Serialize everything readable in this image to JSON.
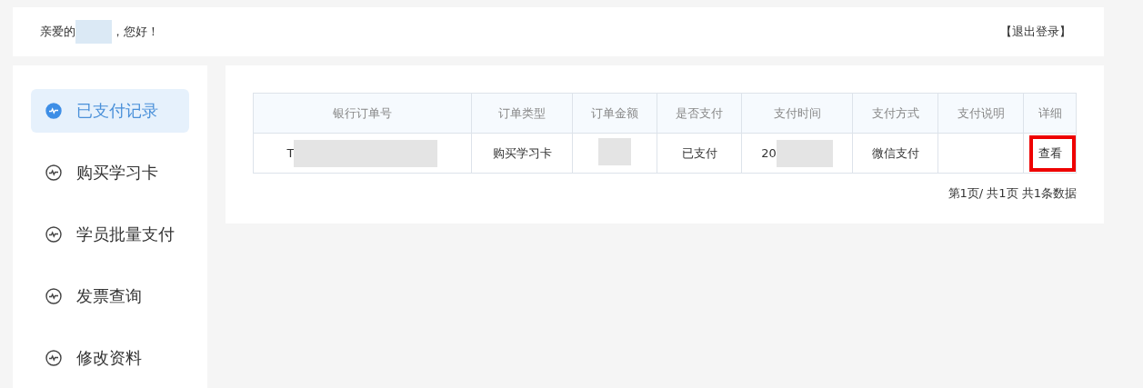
{
  "header": {
    "greeting_prefix": "亲爱的",
    "name_redacted": true,
    "greeting_suffix": "，您好！",
    "logout": "【退出登录】"
  },
  "sidebar": {
    "items": [
      {
        "label": "已支付记录",
        "selected": true
      },
      {
        "label": "购买学习卡",
        "selected": false
      },
      {
        "label": "学员批量支付",
        "selected": false
      },
      {
        "label": "发票查询",
        "selected": false
      },
      {
        "label": "修改资料",
        "selected": false
      }
    ]
  },
  "table": {
    "columns": [
      "银行订单号",
      "订单类型",
      "订单金额",
      "是否支付",
      "支付时间",
      "支付方式",
      "支付说明",
      "详细"
    ],
    "rows": [
      {
        "cells": [
          {
            "kind": "text",
            "text": "T",
            "redacted": true
          },
          {
            "kind": "text",
            "text": "购买学习卡"
          },
          {
            "kind": "text",
            "redacted": true
          },
          {
            "kind": "text",
            "text": "已支付"
          },
          {
            "kind": "text",
            "text": "20",
            "redacted": true
          },
          {
            "kind": "text",
            "text": "微信支付"
          },
          {
            "kind": "empty"
          },
          {
            "kind": "link",
            "text": "查看",
            "highlighted": true
          }
        ]
      }
    ]
  },
  "pagination": "第1页/ 共1页 共1条数据"
}
